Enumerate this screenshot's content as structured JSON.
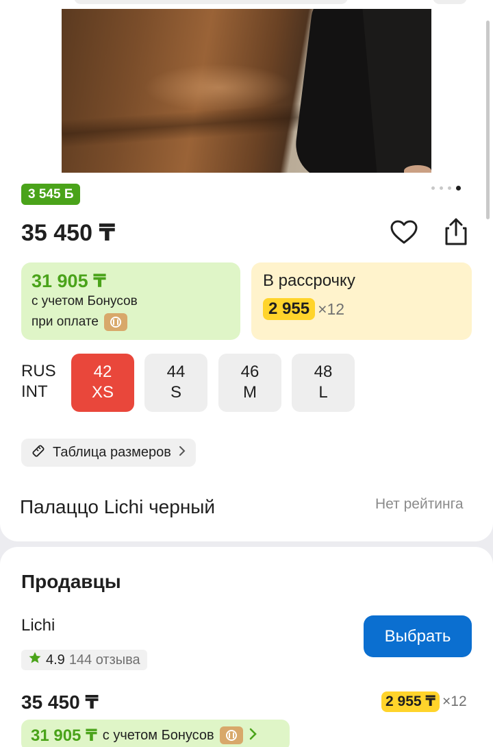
{
  "product": {
    "bonus_badge": "3 545 Б",
    "image_count": 4,
    "active_image_index": 3,
    "price": "35 450 ₸",
    "title": "Палаццо Lichi черный",
    "rating_text": "Нет рейтинга"
  },
  "bonus_offer": {
    "price": "31 905 ₸",
    "line1": "с учетом Бонусов",
    "line2": "при оплате"
  },
  "installment": {
    "title": "В рассрочку",
    "amount": "2 955",
    "multiplier": "×12"
  },
  "sizes": {
    "label_rus": "RUS",
    "label_int": "INT",
    "options": [
      {
        "rus": "42",
        "int": "XS",
        "selected": true
      },
      {
        "rus": "44",
        "int": "S",
        "selected": false
      },
      {
        "rus": "46",
        "int": "M",
        "selected": false
      },
      {
        "rus": "48",
        "int": "L",
        "selected": false
      }
    ],
    "table_link": "Таблица размеров"
  },
  "sellers": {
    "title": "Продавцы",
    "seller": {
      "name": "Lichi",
      "rating": "4.9",
      "reviews": "144 отзыва",
      "choose_label": "Выбрать",
      "price": "35 450 ₸",
      "installment_amount": "2 955 ₸",
      "installment_multiplier": "×12",
      "bonus_price": "31 905 ₸",
      "bonus_text": "с учетом Бонусов"
    }
  },
  "colors": {
    "accent_green": "#4aa31a",
    "accent_blue": "#0b6fd0",
    "selected_red": "#e9473b",
    "installment_yellow": "#ffd42b"
  }
}
